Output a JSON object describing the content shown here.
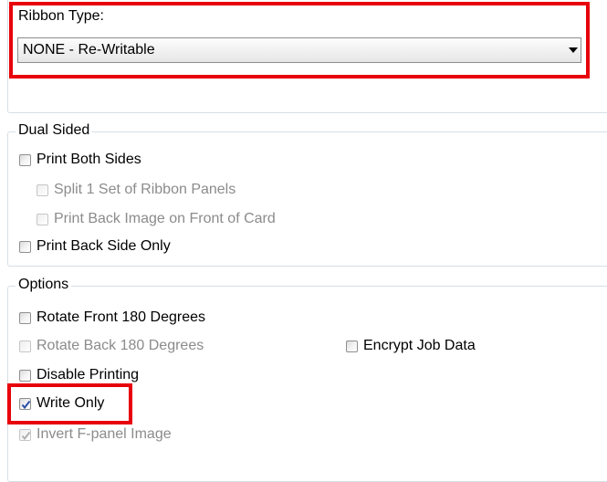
{
  "ribbon": {
    "label": "Ribbon Type:",
    "selected": "NONE - Re-Writable"
  },
  "dual_sided": {
    "legend": "Dual Sided",
    "items": [
      {
        "label": "Print Both Sides",
        "checked": false,
        "enabled": true
      },
      {
        "label": "Split 1 Set of Ribbon Panels",
        "checked": false,
        "enabled": false
      },
      {
        "label": "Print Back Image on Front of Card",
        "checked": false,
        "enabled": false
      },
      {
        "label": "Print Back Side Only",
        "checked": false,
        "enabled": true
      }
    ]
  },
  "options": {
    "legend": "Options",
    "items": [
      {
        "label": "Rotate Front 180 Degrees",
        "checked": false,
        "enabled": true
      },
      {
        "label": "Rotate Back 180 Degrees",
        "checked": false,
        "enabled": false
      },
      {
        "label": "Encrypt Job Data",
        "checked": false,
        "enabled": true
      },
      {
        "label": "Disable Printing",
        "checked": false,
        "enabled": true
      },
      {
        "label": "Write Only",
        "checked": true,
        "enabled": true
      },
      {
        "label": "Invert F-panel Image",
        "checked": true,
        "enabled": false
      }
    ]
  },
  "colors": {
    "highlight_red": "#e8000b",
    "check_blue": "#2d4fa8",
    "disabled_text": "#8b8b8b",
    "group_border": "#d5dfe5"
  }
}
